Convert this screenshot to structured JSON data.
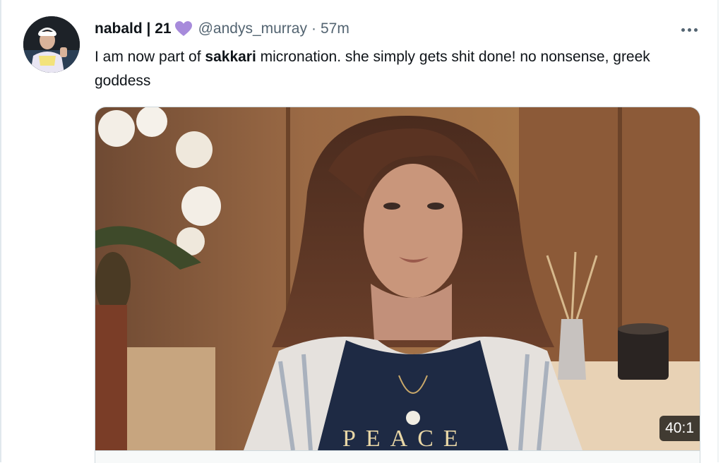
{
  "tweet": {
    "display_name": "nabald | 21",
    "handle": "@andys_murray",
    "separator": "·",
    "time": "57m",
    "text_before": "I am now part of ",
    "text_bold": "sakkari",
    "text_after": " micronation. she simply gets shit done! no nonsense, greek goddess",
    "video_duration": "40:1",
    "heart_color": "#a78bdb",
    "accent_color": "#536471",
    "icons": {
      "name_badge": "purple-heart-icon",
      "more": "more-options-icon",
      "avatar": "avatar-image"
    }
  }
}
